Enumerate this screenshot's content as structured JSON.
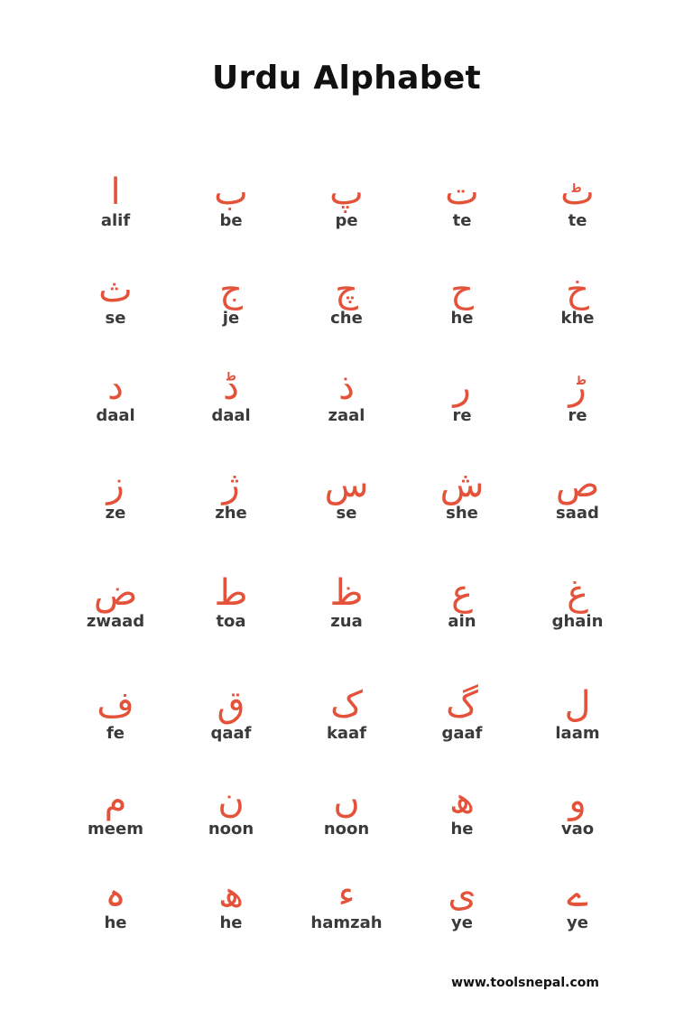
{
  "title": "Urdu Alphabet",
  "colors": {
    "glyph": "#e4523a",
    "name": "#3a3a3a",
    "title": "#111111",
    "background": "#ffffff"
  },
  "letters": [
    {
      "glyph": "ا",
      "name": "alif"
    },
    {
      "glyph": "ب",
      "name": "be"
    },
    {
      "glyph": "پ",
      "name": "pe"
    },
    {
      "glyph": "ت",
      "name": "te"
    },
    {
      "glyph": "ٹ",
      "name": "te"
    },
    {
      "glyph": "ث",
      "name": "se"
    },
    {
      "glyph": "ج",
      "name": "je"
    },
    {
      "glyph": "چ",
      "name": "che"
    },
    {
      "glyph": "ح",
      "name": "he"
    },
    {
      "glyph": "خ",
      "name": "khe"
    },
    {
      "glyph": "د",
      "name": "daal"
    },
    {
      "glyph": "ڈ",
      "name": "daal"
    },
    {
      "glyph": "ذ",
      "name": "zaal"
    },
    {
      "glyph": "ر",
      "name": "re"
    },
    {
      "glyph": "ڑ",
      "name": "re"
    },
    {
      "glyph": "ز",
      "name": "ze"
    },
    {
      "glyph": "ژ",
      "name": "zhe"
    },
    {
      "glyph": "س",
      "name": "se"
    },
    {
      "glyph": "ش",
      "name": "she"
    },
    {
      "glyph": "ص",
      "name": "saad"
    },
    {
      "glyph": "ض",
      "name": "zwaad"
    },
    {
      "glyph": "ط",
      "name": "toa"
    },
    {
      "glyph": "ظ",
      "name": "zua"
    },
    {
      "glyph": "ع",
      "name": "ain"
    },
    {
      "glyph": "غ",
      "name": "ghain"
    },
    {
      "glyph": "ف",
      "name": "fe"
    },
    {
      "glyph": "ق",
      "name": "qaaf"
    },
    {
      "glyph": "ک",
      "name": "kaaf"
    },
    {
      "glyph": "گ",
      "name": "gaaf"
    },
    {
      "glyph": "ل",
      "name": "laam"
    },
    {
      "glyph": "م",
      "name": "meem"
    },
    {
      "glyph": "ن",
      "name": "noon"
    },
    {
      "glyph": "ں",
      "name": "noon"
    },
    {
      "glyph": "ھ",
      "name": "he"
    },
    {
      "glyph": "و",
      "name": "vao"
    },
    {
      "glyph": "ہ",
      "name": "he"
    },
    {
      "glyph": "ھ",
      "name": "he"
    },
    {
      "glyph": "ء",
      "name": "hamzah"
    },
    {
      "glyph": "ی",
      "name": "ye"
    },
    {
      "glyph": "ے",
      "name": "ye"
    }
  ],
  "footer": "www.toolsnepal.com"
}
